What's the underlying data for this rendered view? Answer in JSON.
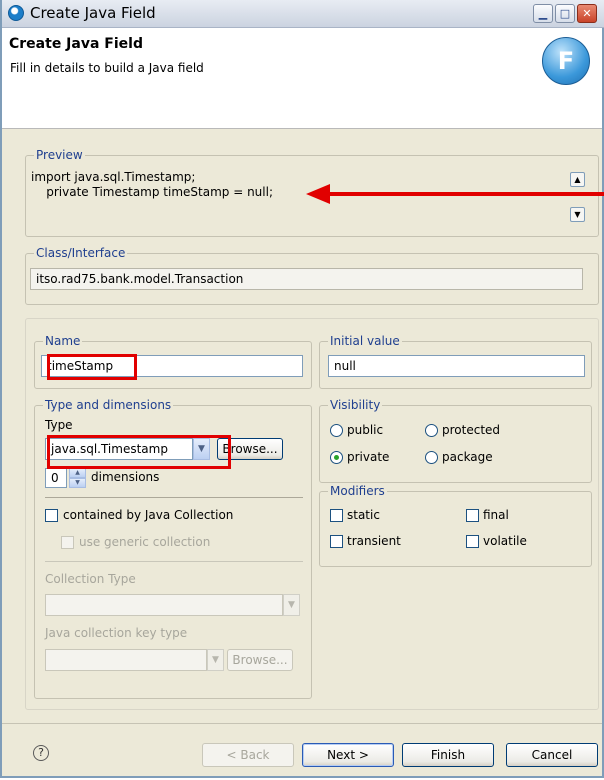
{
  "window": {
    "title": "Create Java Field"
  },
  "header": {
    "title": "Create Java Field",
    "subtitle": "Fill in details to build a Java field",
    "badge_letter": "F"
  },
  "preview": {
    "legend": "Preview",
    "line1": "import java.sql.Timestamp;",
    "line2": "    private Timestamp timeStamp = null;"
  },
  "class_interface": {
    "legend": "Class/Interface",
    "value": "itso.rad75.bank.model.Transaction"
  },
  "name": {
    "legend": "Name",
    "value": "timeStamp"
  },
  "initial_value": {
    "legend": "Initial value",
    "value": "null"
  },
  "type_dims": {
    "legend": "Type and dimensions",
    "type_label": "Type",
    "type_value": "java.sql.Timestamp",
    "browse_label": "Browse...",
    "dimensions_value": "0",
    "dimensions_label": "dimensions",
    "contained_label": "contained by Java Collection",
    "generic_label": "use generic collection",
    "collection_type_label": "Collection Type",
    "key_type_label": "Java collection key type",
    "browse2_label": "Browse..."
  },
  "visibility": {
    "legend": "Visibility",
    "options": [
      {
        "label": "public",
        "selected": false
      },
      {
        "label": "protected",
        "selected": false
      },
      {
        "label": "private",
        "selected": true
      },
      {
        "label": "package",
        "selected": false
      }
    ]
  },
  "modifiers": {
    "legend": "Modifiers",
    "options": [
      {
        "label": "static",
        "checked": false
      },
      {
        "label": "final",
        "checked": false
      },
      {
        "label": "transient",
        "checked": false
      },
      {
        "label": "volatile",
        "checked": false
      }
    ]
  },
  "footer": {
    "help": "?",
    "back": "< Back",
    "next": "Next >",
    "finish": "Finish",
    "cancel": "Cancel"
  },
  "colors": {
    "highlight": "#e10000",
    "legend": "#1f3f8f",
    "dialog_bg": "#ece9d8"
  },
  "icons": {
    "app": "eclipse-app-icon",
    "wizard": "field-wizard-icon",
    "help": "help-icon"
  }
}
